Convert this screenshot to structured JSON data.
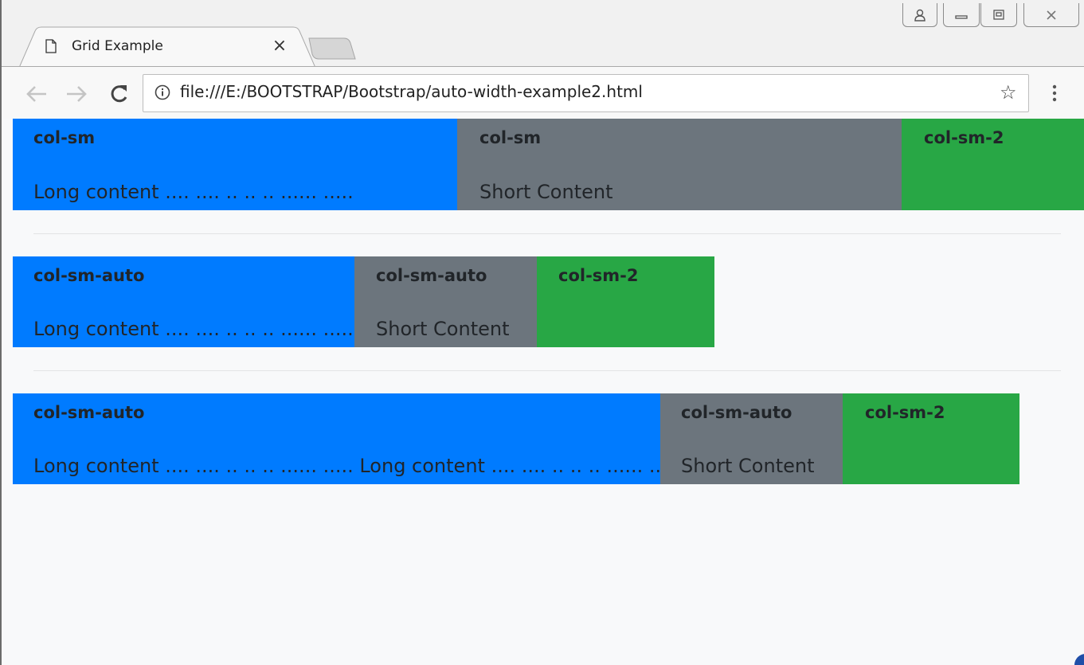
{
  "browser": {
    "tab_title": "Grid Example",
    "tab_close": "×",
    "url": "file:///E:/BOOTSTRAP/Bootstrap/auto-width-example2.html",
    "icons": {
      "profile": "person-icon",
      "minimize": "minimize-icon",
      "maximize": "maximize-icon",
      "close": "close-icon",
      "back": "back-arrow-icon",
      "forward": "forward-arrow-icon",
      "reload": "reload-icon",
      "info": "info-icon",
      "bookmark": "star-icon",
      "menu": "kebab-menu-icon",
      "page": "document-icon"
    }
  },
  "colors": {
    "primary": "#007bff",
    "secondary": "#6c757d",
    "success": "#28a745",
    "page_bg": "#f8f9fa",
    "text": "#212529"
  },
  "rows": [
    {
      "columns": [
        {
          "heading": "col-sm",
          "text": "Long content .... .... .. .. .. ...... .....",
          "color": "blue"
        },
        {
          "heading": "col-sm",
          "text": "Short Content",
          "color": "gray"
        },
        {
          "heading": "col-sm-2",
          "text": "",
          "color": "green"
        }
      ]
    },
    {
      "columns": [
        {
          "heading": "col-sm-auto",
          "text": "Long content .... .... .. .. .. ...... .....",
          "color": "blue"
        },
        {
          "heading": "col-sm-auto",
          "text": "Short Content",
          "color": "gray"
        },
        {
          "heading": "col-sm-2",
          "text": "",
          "color": "green"
        }
      ]
    },
    {
      "columns": [
        {
          "heading": "col-sm-auto",
          "text": "Long content .... .... .. .. .. ...... ..... Long content .... .... .. .. .. ...... .....",
          "color": "blue"
        },
        {
          "heading": "col-sm-auto",
          "text": "Short Content",
          "color": "gray"
        },
        {
          "heading": "col-sm-2",
          "text": "",
          "color": "green"
        }
      ]
    }
  ]
}
